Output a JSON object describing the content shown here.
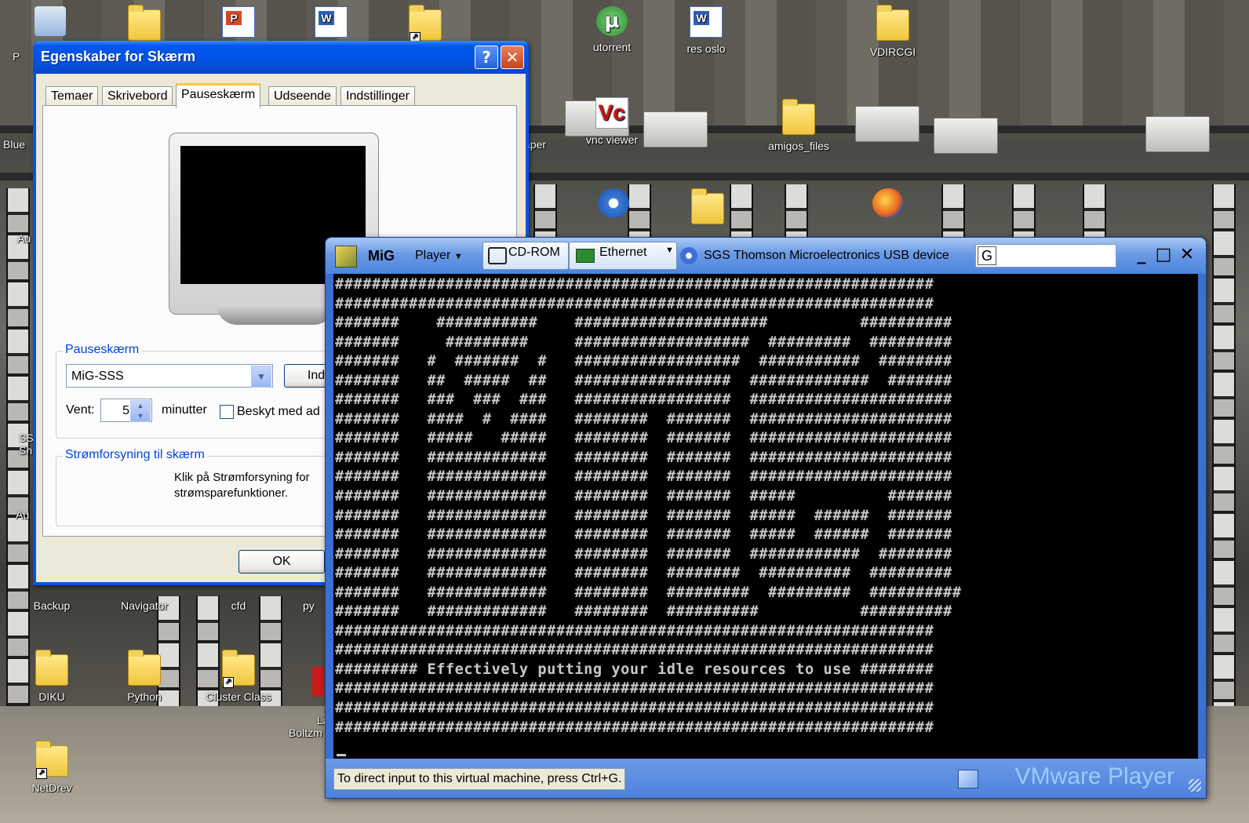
{
  "desktop": {
    "icons": [
      {
        "label": "P",
        "kind": "recycle"
      },
      {
        "label": "",
        "kind": "folder"
      },
      {
        "label": "",
        "kind": "ppt"
      },
      {
        "label": "",
        "kind": "doc"
      },
      {
        "label": "",
        "kind": "folder-shortcut"
      },
      {
        "label": "utorrent",
        "kind": "app"
      },
      {
        "label": "res oslo",
        "kind": "doc"
      },
      {
        "label": "VDIRCGI",
        "kind": "folder"
      },
      {
        "label": "Blue",
        "kind": "app"
      },
      {
        "label": "aper",
        "kind": "app"
      },
      {
        "label": "vnc viewer",
        "kind": "app"
      },
      {
        "label": "amigos_files",
        "kind": "folder"
      },
      {
        "label": "Au",
        "kind": "app"
      },
      {
        "label": "SS\nSh",
        "kind": "app"
      },
      {
        "label": "Au",
        "kind": "app"
      },
      {
        "label": "Backup",
        "kind": "folder"
      },
      {
        "label": "Navigator",
        "kind": "app"
      },
      {
        "label": "cfd",
        "kind": "folder"
      },
      {
        "label": "py",
        "kind": "app"
      },
      {
        "label": "DIKU",
        "kind": "folder"
      },
      {
        "label": "Python",
        "kind": "folder"
      },
      {
        "label": "Cluster Class",
        "kind": "folder-shortcut"
      },
      {
        "label": "La\nBoltzm",
        "kind": "app"
      },
      {
        "label": "NetDrev",
        "kind": "folder-shortcut"
      }
    ]
  },
  "dialog": {
    "title": "Egenskaber for Skærm",
    "help_label": "?",
    "close_label": "✕",
    "tabs": [
      "Temaer",
      "Skrivebord",
      "Pauseskærm",
      "Udseende",
      "Indstillinger"
    ],
    "active_tab": "Pauseskærm",
    "screensaver_group": "Pauseskærm",
    "screensaver_value": "MiG-SSS",
    "settings_button": "Inds",
    "wait_label": "Vent:",
    "wait_value": "5",
    "minutes_label": "minutter",
    "protect_label": "Beskyt med ad",
    "power_group": "Strømforsyning til skærm",
    "power_text_1": "Klik på Strømforsyning for",
    "power_text_2": "strømsparefunktioner.",
    "ok_label": "OK"
  },
  "vmware": {
    "app_name": "MiG",
    "player_menu": "Player",
    "devices": [
      "CD-ROM",
      "Ethernet",
      "SGS Thomson Microelectronics USB device"
    ],
    "search_value": "G",
    "minimize_label": "_",
    "maximize_label": "□",
    "close_label": "✕",
    "status_message": "To direct input to this virtual machine, press Ctrl+G.",
    "brand": "VMware Player",
    "console_lines": [
      "#################################################################",
      "#################################################################",
      "#######    ###########    #####################          ##########",
      "#######     #########     ###################  #########  #########",
      "#######   #  #######  #   ##################  ###########  ########",
      "#######   ##  #####  ##   #################  #############  #######",
      "#######   ###  ###  ###   #################  ######################",
      "#######   ####  #  ####   ########  #######  ######################",
      "#######   #####   #####   ########  #######  ######################",
      "#######   #############   ########  #######  ######################",
      "#######   #############   ########  #######  ######################",
      "#######   #############   ########  #######  #####          #######",
      "#######   #############   ########  #######  #####  ######  #######",
      "#######   #############   ########  #######  #####  ######  #######",
      "#######   #############   ########  #######  ############  ########",
      "#######   #############   ########  ########  ##########  #########",
      "#######   #############   ########  #########  #########  ##########",
      "#######   #############   ########  ##########           ##########",
      "#################################################################",
      "#################################################################",
      "######### Effectively putting your idle resources to use ########",
      "#################################################################",
      "#################################################################",
      "#################################################################"
    ]
  }
}
